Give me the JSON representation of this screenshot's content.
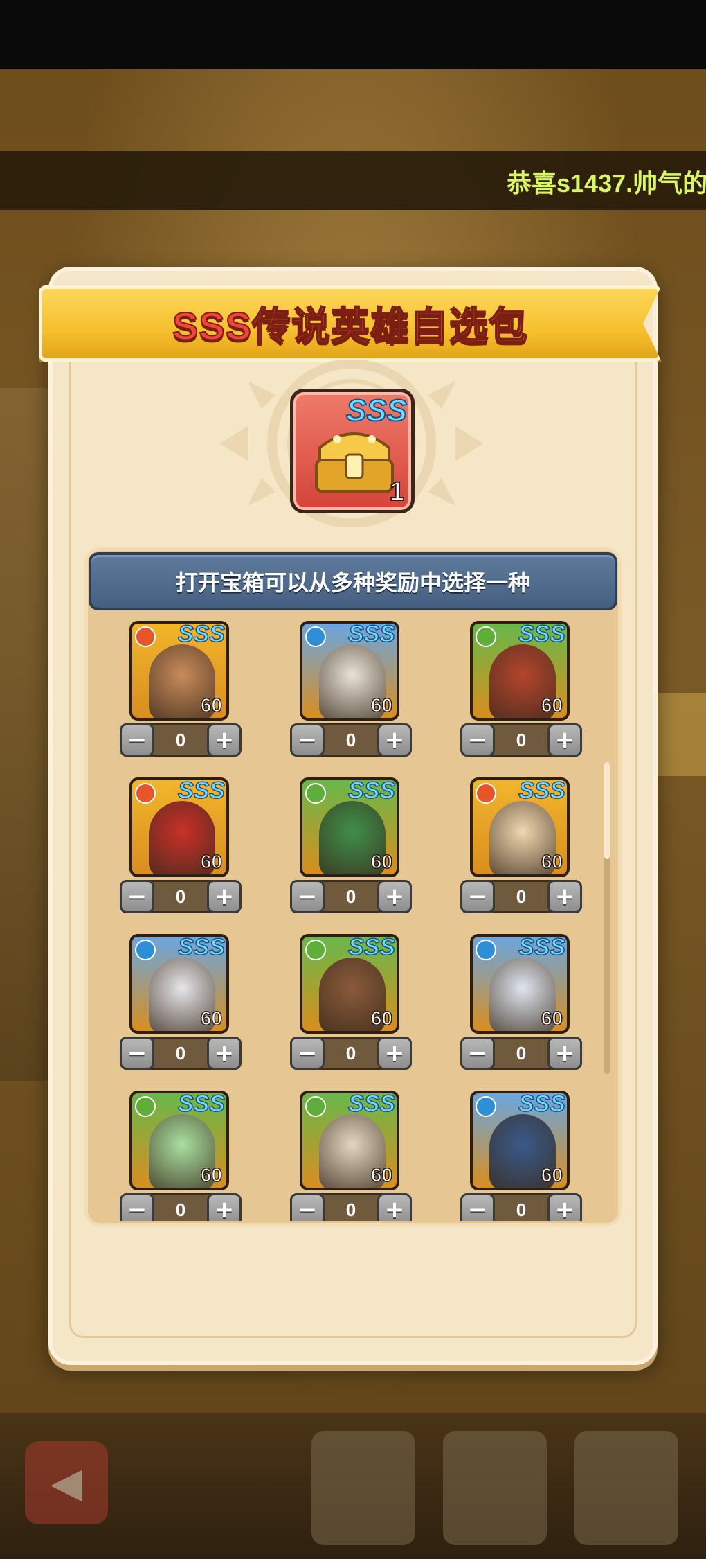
{
  "marquee": {
    "text": "恭喜s1437.帅气的"
  },
  "dialog": {
    "title": "SSS传说英雄自选包",
    "chest": {
      "grade": "SSS",
      "count": "1"
    },
    "info": "打开宝箱可以从多种奖励中选择一种"
  },
  "heroes": [
    {
      "element": "fire",
      "grade": "SSS",
      "level": "60",
      "count": "0",
      "minus": "−",
      "plus": "+"
    },
    {
      "element": "water",
      "grade": "SSS",
      "level": "60",
      "count": "0",
      "minus": "−",
      "plus": "+"
    },
    {
      "element": "leaf",
      "grade": "SSS",
      "level": "60",
      "count": "0",
      "minus": "−",
      "plus": "+"
    },
    {
      "element": "fire",
      "grade": "SSS",
      "level": "60",
      "count": "0",
      "minus": "−",
      "plus": "+"
    },
    {
      "element": "leaf",
      "grade": "SSS",
      "level": "60",
      "count": "0",
      "minus": "−",
      "plus": "+"
    },
    {
      "element": "fire",
      "grade": "SSS",
      "level": "60",
      "count": "0",
      "minus": "−",
      "plus": "+"
    },
    {
      "element": "water",
      "grade": "SSS",
      "level": "60",
      "count": "0",
      "minus": "−",
      "plus": "+"
    },
    {
      "element": "leaf",
      "grade": "SSS",
      "level": "60",
      "count": "0",
      "minus": "−",
      "plus": "+"
    },
    {
      "element": "water",
      "grade": "SSS",
      "level": "60",
      "count": "0",
      "minus": "−",
      "plus": "+"
    },
    {
      "element": "leaf",
      "grade": "SSS",
      "level": "60",
      "count": "0",
      "minus": "−",
      "plus": "+"
    },
    {
      "element": "leaf",
      "grade": "SSS",
      "level": "60",
      "count": "0",
      "minus": "−",
      "plus": "+"
    },
    {
      "element": "water",
      "grade": "SSS",
      "level": "60",
      "count": "0",
      "minus": "−",
      "plus": "+"
    }
  ],
  "colors": {
    "fire": "#e8552a",
    "water": "#2e8fd6",
    "leaf": "#5fae3a",
    "card_gold": "#f2b52c",
    "card_blue": "#6aa6e0",
    "card_green": "#68b84a"
  }
}
